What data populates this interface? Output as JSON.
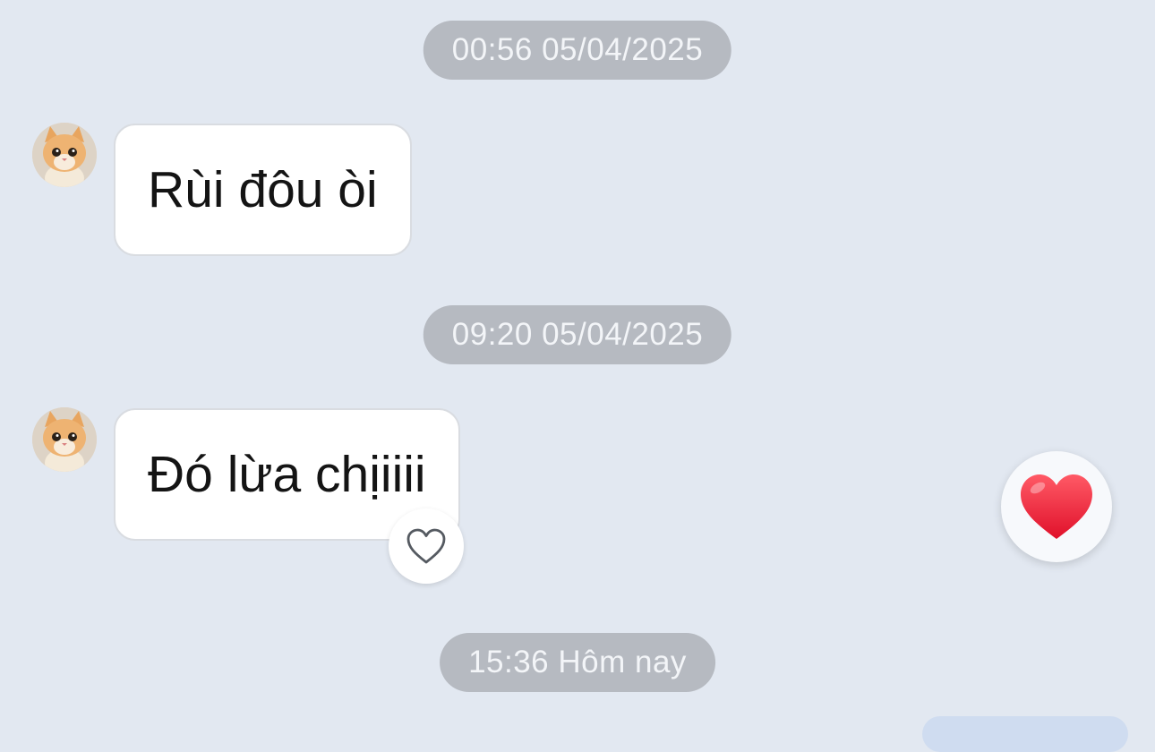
{
  "conversation": {
    "timestamps": [
      {
        "label": "00:56 05/04/2025"
      },
      {
        "label": "09:20 05/04/2025"
      },
      {
        "label": "15:36 Hôm nay"
      }
    ],
    "messages": [
      {
        "text": "Rùi đôu òi",
        "sender": "contact",
        "avatar": "kitten-avatar"
      },
      {
        "text": "Đó lừa chịiiii",
        "sender": "contact",
        "avatar": "kitten-avatar",
        "reaction_button": "heart-outline-icon"
      }
    ],
    "quick_reaction": {
      "icon": "red-heart-icon",
      "color": "#ff2d3f"
    }
  },
  "colors": {
    "background": "#e2e8f1",
    "timestamp_pill": "#b6bac1",
    "bubble": "#ffffff"
  }
}
